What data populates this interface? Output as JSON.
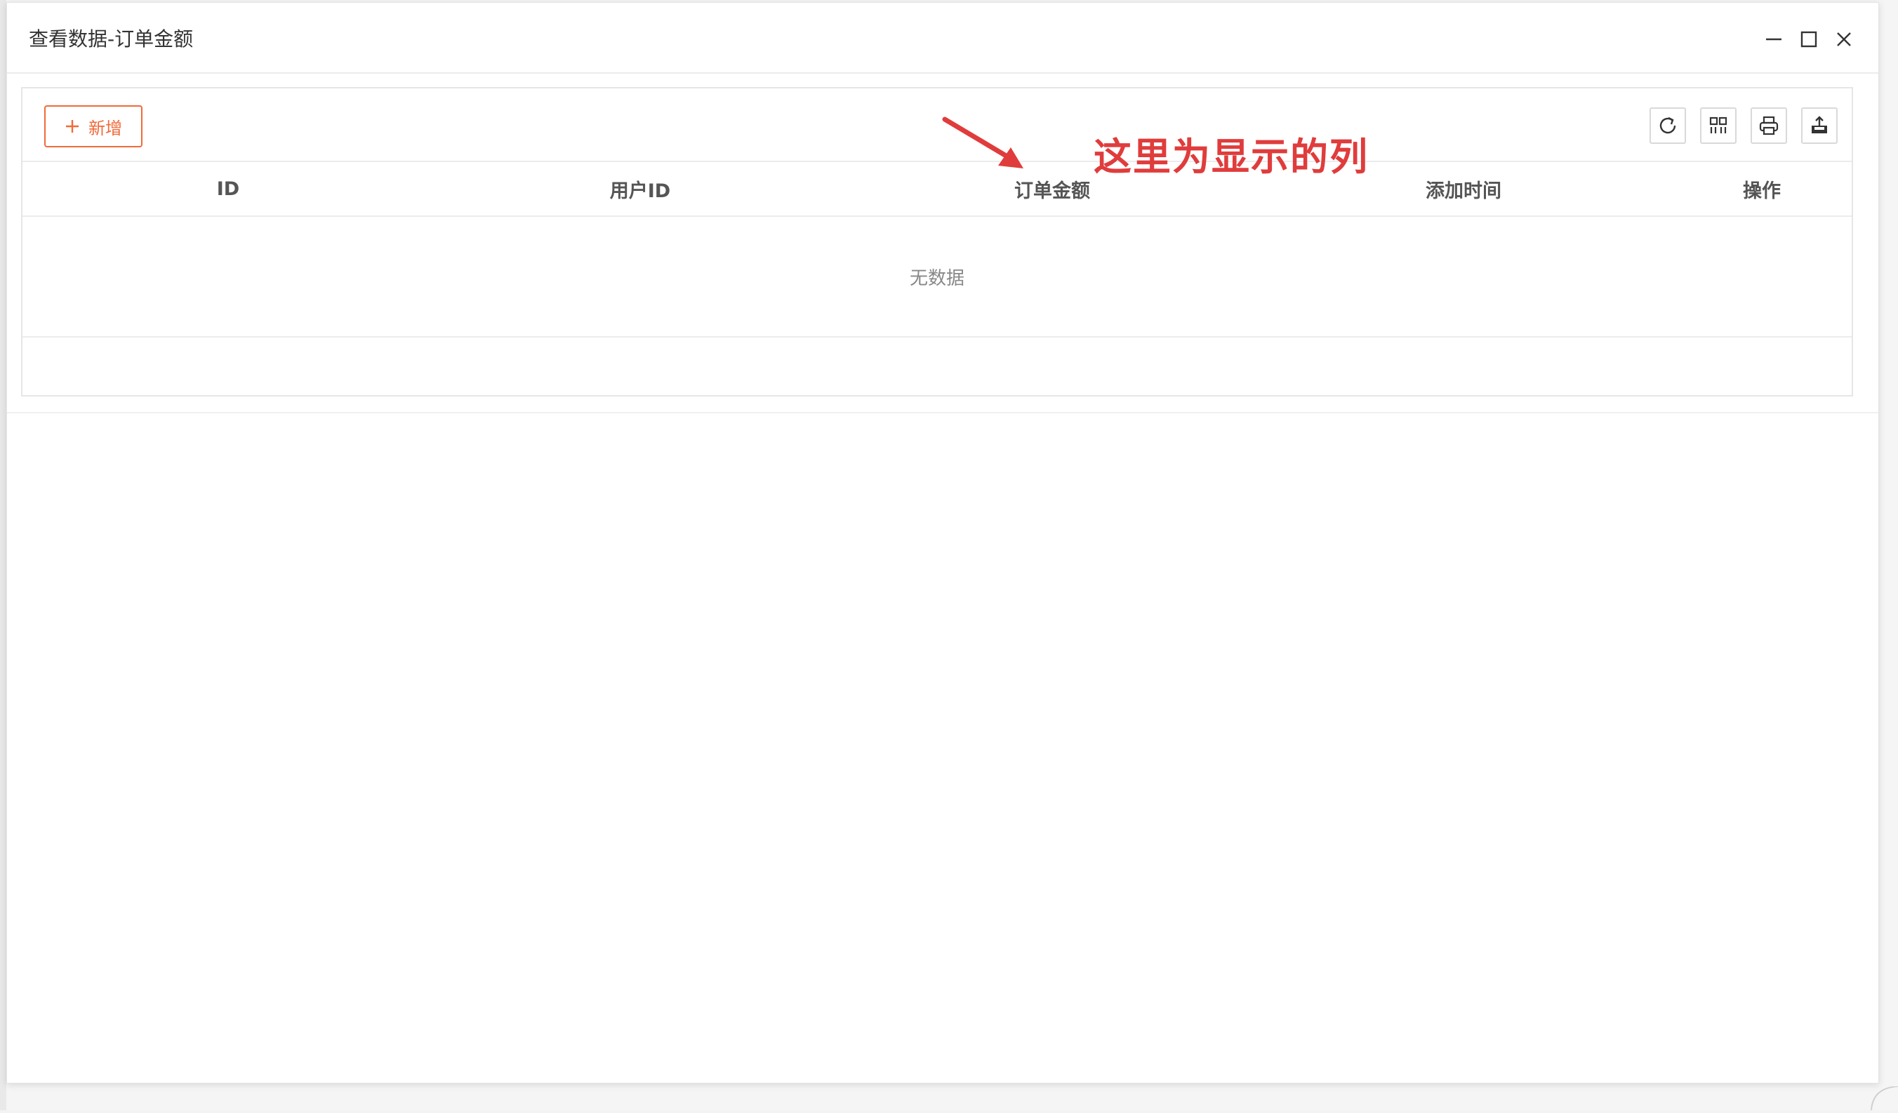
{
  "dialog": {
    "title": "查看数据-订单金额",
    "controls": {
      "minimize_icon": "minimize-icon",
      "maximize_icon": "maximize-icon",
      "close_icon": "close-icon"
    }
  },
  "toolbar": {
    "add_label": "新增",
    "add_icon": "plus-icon",
    "tools": [
      "refresh-icon",
      "columns-icon",
      "print-icon",
      "export-icon"
    ]
  },
  "table": {
    "columns": [
      "ID",
      "用户ID",
      "订单金额",
      "添加时间",
      "操作"
    ],
    "empty_text": "无数据"
  },
  "annotation": {
    "text": "这里为显示的列",
    "color": "#e03c3c"
  },
  "colors": {
    "accent": "#f06a3a",
    "header_text": "#555555",
    "border": "#e6e6e6"
  }
}
